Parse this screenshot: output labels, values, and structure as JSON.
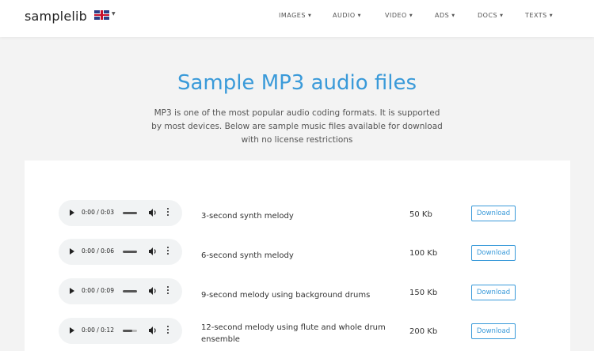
{
  "header": {
    "logo": "samplelib",
    "flag_icon": "uk-flag-icon",
    "nav": [
      {
        "label": "IMAGES"
      },
      {
        "label": "AUDIO"
      },
      {
        "label": "VIDEO"
      },
      {
        "label": "ADS"
      },
      {
        "label": "DOCS"
      },
      {
        "label": "TEXTS"
      }
    ]
  },
  "hero": {
    "title": "Sample MP3 audio files",
    "intro": "MP3 is one of the most popular audio coding formats. It is supported by most devices. Below are sample music files available for download with no license restrictions"
  },
  "files": [
    {
      "time": "0:00 / 0:03",
      "description": "3-second synth melody",
      "size": "50 Kb",
      "download": "Download"
    },
    {
      "time": "0:00 / 0:06",
      "description": "6-second synth melody",
      "size": "100 Kb",
      "download": "Download"
    },
    {
      "time": "0:00 / 0:09",
      "description": "9-second melody using background drums",
      "size": "150 Kb",
      "download": "Download"
    },
    {
      "time": "0:00 / 0:12",
      "description": "12-second melody using flute and whole drum ensemble",
      "size": "200 Kb",
      "download": "Download"
    }
  ],
  "colors": {
    "accent": "#3a9ad9",
    "background": "#f3f3f3",
    "card": "#ffffff",
    "player": "#f1f3f4"
  }
}
